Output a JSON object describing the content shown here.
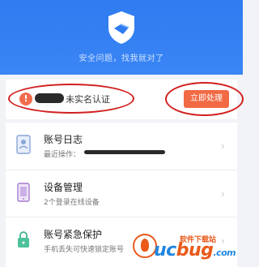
{
  "header": {
    "slogan": "安全问题，找我就对了"
  },
  "alert": {
    "icon_text": "!",
    "text": "未实名认证",
    "button_label": "立即处理",
    "colors": {
      "button": "#f26a44",
      "highlight": "#d21f1f"
    }
  },
  "items": [
    {
      "title": "账号日志",
      "subtitle": "最近操作：",
      "icon": "user-card-icon",
      "chevron": "›"
    },
    {
      "title": "设备管理",
      "subtitle": "2个登录在线设备",
      "icon": "device-icon",
      "chevron": "›"
    },
    {
      "title": "账号紧急保护",
      "subtitle": "手机丢失可快速锁定账号",
      "icon": "lock-icon",
      "chevron": "›"
    }
  ],
  "watermark": {
    "main_left": "uc",
    "main_right": "bug",
    "suffix": ".com",
    "small": "软件下载站"
  },
  "colors": {
    "header": "#3a86f5",
    "background": "#f2f3f7"
  }
}
